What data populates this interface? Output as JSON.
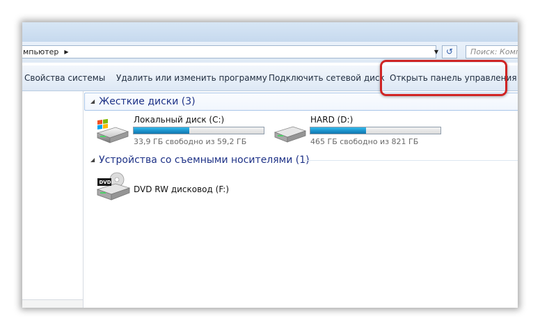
{
  "address": {
    "path": "мпьютер",
    "search_placeholder": "Поиск: Компьютер"
  },
  "toolbar": {
    "items": [
      "Свойства системы",
      "Удалить или изменить программу",
      "Подключить сетевой диск",
      "Открыть панель управления"
    ]
  },
  "groups": [
    {
      "title": "Жесткие диски (3)",
      "drives": [
        {
          "name": "Локальный диск (C:)",
          "free": "33,9 ГБ свободно из 59,2 ГБ",
          "used_fraction": 0.43,
          "icon": "windows-drive-icon"
        },
        {
          "name": "HARD (D:)",
          "free": "465 ГБ свободно из 821 ГБ",
          "used_fraction": 0.43,
          "icon": "hard-drive-icon"
        }
      ]
    },
    {
      "title": "Устройства со съемными носителями (1)",
      "drives": [
        {
          "name": "DVD RW дисковод (F:)",
          "icon": "dvd-drive-icon",
          "icon_label": "DVD"
        }
      ]
    }
  ],
  "colors": {
    "highlight": "#cf2424",
    "bar_fill": "#2aa6de",
    "group_title": "#1e3287"
  }
}
